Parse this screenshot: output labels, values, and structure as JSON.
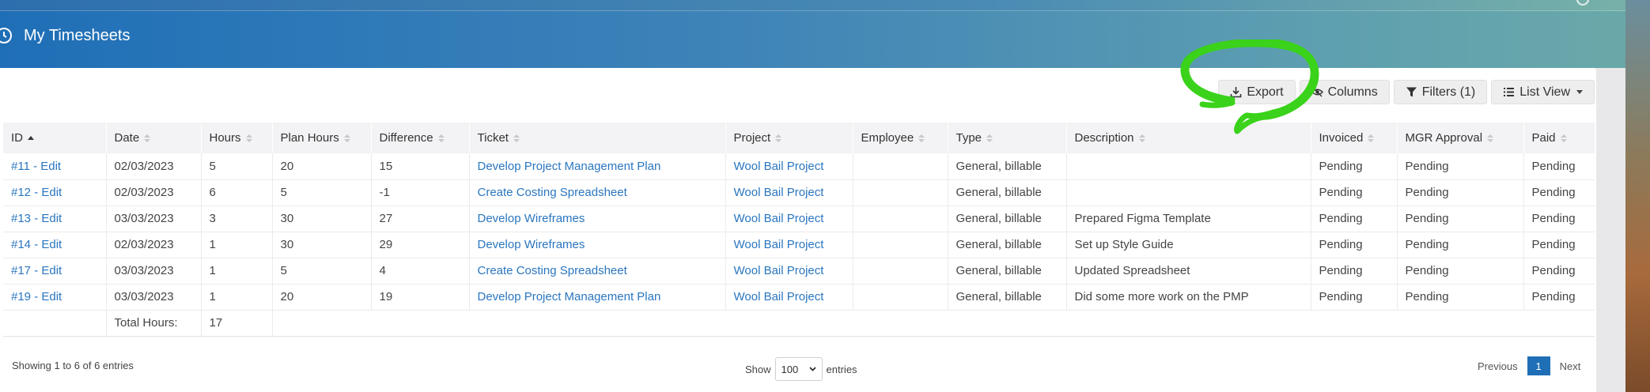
{
  "header": {
    "title": "My Timesheets",
    "icon": "clock-icon"
  },
  "toolbar": {
    "export_label": "Export",
    "columns_label": "Columns",
    "filters_label": "Filters (1)",
    "list_view_label": "List View"
  },
  "table": {
    "columns": [
      "ID",
      "Date",
      "Hours",
      "Plan Hours",
      "Difference",
      "Ticket",
      "Project",
      "Employee",
      "Type",
      "Description",
      "Invoiced",
      "MGR Approval",
      "Paid"
    ],
    "rows": [
      {
        "id": "#11 - Edit",
        "date": "02/03/2023",
        "hours": "5",
        "plan": "20",
        "diff": "15",
        "ticket": "Develop Project Management Plan",
        "project": "Wool Bail Project",
        "employee": "",
        "type": "General, billable",
        "description": "",
        "invoiced": "Pending",
        "mgr": "Pending",
        "paid": "Pending"
      },
      {
        "id": "#12 - Edit",
        "date": "02/03/2023",
        "hours": "6",
        "plan": "5",
        "diff": "-1",
        "ticket": "Create Costing Spreadsheet",
        "project": "Wool Bail Project",
        "employee": "",
        "type": "General, billable",
        "description": "",
        "invoiced": "Pending",
        "mgr": "Pending",
        "paid": "Pending"
      },
      {
        "id": "#13 - Edit",
        "date": "03/03/2023",
        "hours": "3",
        "plan": "30",
        "diff": "27",
        "ticket": "Develop Wireframes",
        "project": "Wool Bail Project",
        "employee": "",
        "type": "General, billable",
        "description": "Prepared Figma Template",
        "invoiced": "Pending",
        "mgr": "Pending",
        "paid": "Pending"
      },
      {
        "id": "#14 - Edit",
        "date": "02/03/2023",
        "hours": "1",
        "plan": "30",
        "diff": "29",
        "ticket": "Develop Wireframes",
        "project": "Wool Bail Project",
        "employee": "",
        "type": "General, billable",
        "description": "Set up Style Guide",
        "invoiced": "Pending",
        "mgr": "Pending",
        "paid": "Pending"
      },
      {
        "id": "#17 - Edit",
        "date": "03/03/2023",
        "hours": "1",
        "plan": "5",
        "diff": "4",
        "ticket": "Create Costing Spreadsheet",
        "project": "Wool Bail Project",
        "employee": "",
        "type": "General, billable",
        "description": "Updated Spreadsheet",
        "invoiced": "Pending",
        "mgr": "Pending",
        "paid": "Pending"
      },
      {
        "id": "#19 - Edit",
        "date": "03/03/2023",
        "hours": "1",
        "plan": "20",
        "diff": "19",
        "ticket": "Develop Project Management Plan",
        "project": "Wool Bail Project",
        "employee": "",
        "type": "General, billable",
        "description": "Did some more work on the PMP",
        "invoiced": "Pending",
        "mgr": "Pending",
        "paid": "Pending"
      }
    ],
    "total_label": "Total Hours:",
    "total_value": "17"
  },
  "footer": {
    "info": "Showing 1 to 6 of 6 entries",
    "show_label": "Show",
    "show_value": "100",
    "entries_label": "entries",
    "previous": "Previous",
    "page": "1",
    "next": "Next"
  },
  "colors": {
    "header_blue": "#1f6fb7",
    "link": "#2a76c0",
    "annotation_green": "#3ad21a"
  }
}
